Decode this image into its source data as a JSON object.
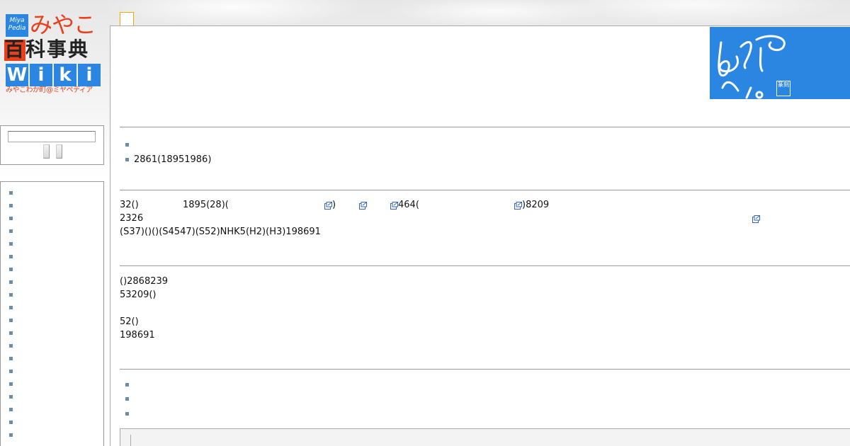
{
  "logo": {
    "miya_label": "Miya Pedia",
    "miyako": "みやこ",
    "hyakka": "百科事典",
    "wiki_letters": [
      "W",
      "i",
      "k",
      "i"
    ],
    "subtitle": "みやこわか町@ミヤペディア",
    "colors": {
      "blue": "#2a86e0",
      "orange": "#e8401c"
    }
  },
  "search": {
    "value": "",
    "placeholder": ""
  },
  "sidebar": {
    "item_count": 21
  },
  "banner": {
    "seal_text": "篆刻",
    "color": "#2a86e0"
  },
  "content": {
    "summary_items": [
      "",
      "2861(18951986)"
    ],
    "section1": {
      "l1a": "32()",
      "l1b": "1895(28)(",
      "l1c": ")",
      "l1d": "464(",
      "l1e": ")8209",
      "l2": "2326",
      "l3": "(S37)()()(S4547)(S52)NHK5(H2)(H3)198691"
    },
    "section2": {
      "l1": "()2868239",
      "l2": "53209()",
      "l3": "52()",
      "l4": "198691"
    },
    "link_items": [
      "",
      "",
      ""
    ]
  },
  "icons": {
    "external_link": "external-link-icon",
    "list_bullet": "square-bullet"
  }
}
